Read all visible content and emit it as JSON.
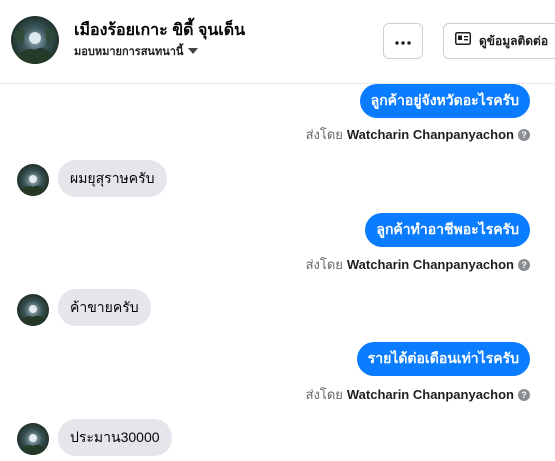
{
  "header": {
    "contact_name": "เมืองร้อยเกาะ ขิดี้ จุนเด็น",
    "status": "มอบหมายการสนทนานี้",
    "more_button_label": "...",
    "info_button_label": "ดูข้อมูลติดต่อ",
    "more_icon": "more-dots-icon",
    "info_icon": "contact-card-icon"
  },
  "colors": {
    "outgoing_bubble": "#0a7cff",
    "incoming_bubble": "#e4e6eb",
    "muted_text": "#65676b"
  },
  "messages": [
    {
      "direction": "out",
      "text": "ลูกค้าอยู่จังหวัดอะไรครับ",
      "sent_prefix": "ส่งโดย",
      "sender": "Watcharin Chanpanyachon"
    },
    {
      "direction": "in",
      "text": "ผมยุสุราษครับ"
    },
    {
      "direction": "out",
      "text": "ลูกค้าทำอาชีพอะไรครับ",
      "sent_prefix": "ส่งโดย",
      "sender": "Watcharin Chanpanyachon"
    },
    {
      "direction": "in",
      "text": "ค้าขายครับ"
    },
    {
      "direction": "out",
      "text": "รายได้ต่อเดือนเท่าไรครับ",
      "sent_prefix": "ส่งโดย",
      "sender": "Watcharin Chanpanyachon"
    },
    {
      "direction": "in",
      "text": "ประมาน30000"
    }
  ]
}
